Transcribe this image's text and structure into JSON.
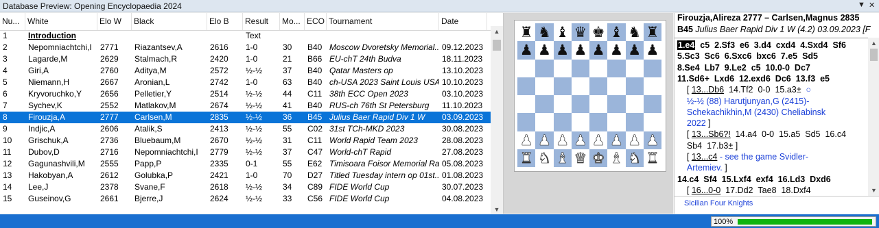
{
  "window": {
    "title": "Database Preview: Opening Encyclopaedia 2024",
    "pin_glyph": "▼",
    "close_glyph": "✕"
  },
  "list": {
    "columns": [
      "Nu...",
      "White",
      "Elo W",
      "Black",
      "Elo B",
      "Result",
      "Mo...",
      "ECO",
      "Tournament",
      "Date"
    ],
    "rows": [
      {
        "num": "1",
        "white": "Introduction",
        "elow": "",
        "black": "",
        "elob": "",
        "result": "Text",
        "moves": "",
        "eco": "",
        "tournament": "",
        "date": ""
      },
      {
        "num": "2",
        "white": "Nepomniachtchi,I",
        "elow": "2771",
        "black": "Riazantsev,A",
        "elob": "2616",
        "result": "1-0",
        "moves": "30",
        "eco": "B40",
        "tournament": "Moscow Dvoretsky Memorial..",
        "date": "09.12.2023"
      },
      {
        "num": "3",
        "white": "Lagarde,M",
        "elow": "2629",
        "black": "Stalmach,R",
        "elob": "2420",
        "result": "1-0",
        "moves": "21",
        "eco": "B66",
        "tournament": "EU-chT 24th Budva",
        "date": "18.11.2023"
      },
      {
        "num": "4",
        "white": "Giri,A",
        "elow": "2760",
        "black": "Aditya,M",
        "elob": "2572",
        "result": "½-½",
        "moves": "37",
        "eco": "B40",
        "tournament": "Qatar Masters op",
        "date": "13.10.2023"
      },
      {
        "num": "5",
        "white": "Niemann,H",
        "elow": "2667",
        "black": "Aronian,L",
        "elob": "2742",
        "result": "1-0",
        "moves": "63",
        "eco": "B40",
        "tournament": "ch-USA 2023 Saint Louis USA",
        "date": "10.10.2023"
      },
      {
        "num": "6",
        "white": "Kryvoruchko,Y",
        "elow": "2656",
        "black": "Pelletier,Y",
        "elob": "2514",
        "result": "½-½",
        "moves": "44",
        "eco": "C11",
        "tournament": "38th ECC Open 2023",
        "date": "03.10.2023"
      },
      {
        "num": "7",
        "white": "Sychev,K",
        "elow": "2552",
        "black": "Matlakov,M",
        "elob": "2674",
        "result": "½-½",
        "moves": "41",
        "eco": "B40",
        "tournament": "RUS-ch 76th St Petersburg",
        "date": "11.10.2023"
      },
      {
        "num": "8",
        "white": "Firouzja,A",
        "elow": "2777",
        "black": "Carlsen,M",
        "elob": "2835",
        "result": "½-½",
        "moves": "36",
        "eco": "B45",
        "tournament": "Julius Baer Rapid Div 1 W",
        "date": "03.09.2023"
      },
      {
        "num": "9",
        "white": "Indjic,A",
        "elow": "2606",
        "black": "Atalik,S",
        "elob": "2413",
        "result": "½-½",
        "moves": "55",
        "eco": "C02",
        "tournament": "31st TCh-MKD 2023",
        "date": "30.08.2023"
      },
      {
        "num": "10",
        "white": "Grischuk,A",
        "elow": "2736",
        "black": "Bluebaum,M",
        "elob": "2670",
        "result": "½-½",
        "moves": "31",
        "eco": "C11",
        "tournament": "World Rapid Team 2023",
        "date": "28.08.2023"
      },
      {
        "num": "11",
        "white": "Dubov,D",
        "elow": "2716",
        "black": "Nepomniachtchi,I",
        "elob": "2779",
        "result": "½-½",
        "moves": "37",
        "eco": "C47",
        "tournament": "World-chT Rapid",
        "date": "27.08.2023"
      },
      {
        "num": "12",
        "white": "Gagunashvili,M",
        "elow": "2555",
        "black": "Papp,P",
        "elob": "2335",
        "result": "0-1",
        "moves": "55",
        "eco": "E62",
        "tournament": "Timisoara Foisor Memorial Ra..",
        "date": "05.08.2023"
      },
      {
        "num": "13",
        "white": "Hakobyan,A",
        "elow": "2612",
        "black": "Golubka,P",
        "elob": "2421",
        "result": "1-0",
        "moves": "70",
        "eco": "D27",
        "tournament": "Titled Tuesday intern op 01st..",
        "date": "01.08.2023"
      },
      {
        "num": "14",
        "white": "Lee,J",
        "elow": "2378",
        "black": "Svane,F",
        "elob": "2618",
        "result": "½-½",
        "moves": "34",
        "eco": "C89",
        "tournament": "FIDE World Cup",
        "date": "30.07.2023"
      },
      {
        "num": "15",
        "white": "Guseinov,G",
        "elow": "2661",
        "black": "Bjerre,J",
        "elob": "2624",
        "result": "½-½",
        "moves": "33",
        "eco": "C56",
        "tournament": "FIDE World Cup",
        "date": "04.08.2023"
      }
    ],
    "selected_index": 7
  },
  "board": {
    "ranks": [
      "r n q k b r",
      "pppppppp",
      "        ",
      "        ",
      "        ",
      "        ",
      "PPPPPPPP",
      "RNBQKBNR"
    ],
    "rank_strings": [
      "rnbqkbnr",
      "pppppppp",
      "........",
      "........",
      "........",
      "........",
      "PPPPPPPP",
      "RNBQKBNR"
    ]
  },
  "notation": {
    "header_players": "Firouzja,Alireza 2777 – Carlsen,Magnus 2835",
    "header_eco": "B45",
    "header_event": "Julius Baer Rapid Div 1 W (4.2) 03.09.2023",
    "header_tail": "[F",
    "lines": [
      [
        {
          "t": "1.e4",
          "c": "mb cur"
        },
        {
          "t": "  c5  2.Sf3  e6  3.d4  cxd4  4.Sxd4  Sf6",
          "c": "mb"
        }
      ],
      [
        {
          "t": "5.Sc3  Sc6  6.Sxc6  bxc6  7.e5  Sd5",
          "c": "mb"
        }
      ],
      [
        {
          "t": "8.Se4  Lb7  9.Le2  c5  10.0-0  Dc7",
          "c": "mb"
        }
      ],
      [
        {
          "t": "11.Sd6+  Lxd6  12.exd6  Dc6  13.f3  e5",
          "c": "mb"
        }
      ],
      [
        {
          "t": "    [ ",
          "c": ""
        },
        {
          "t": "13...Db6",
          "c": "u"
        },
        {
          "t": "  14.Tf2  0-0  15.a3±",
          "c": ""
        },
        {
          "t": "  ○",
          "c": "blue"
        }
      ],
      [
        {
          "t": "    ½-½ (88) Harutjunyan,G (2415)-",
          "c": "blue"
        }
      ],
      [
        {
          "t": "    Schekachikhin,M (2430) Cheliabinsk",
          "c": "blue"
        }
      ],
      [
        {
          "t": "    2022",
          "c": "blue"
        },
        {
          "t": " ]",
          "c": ""
        }
      ],
      [
        {
          "t": "    [ ",
          "c": ""
        },
        {
          "t": "13...Sb6?!",
          "c": "u"
        },
        {
          "t": "  14.a4  0-0  15.a5  Sd5  16.c4",
          "c": ""
        }
      ],
      [
        {
          "t": "    Sb4  17.b3± ]",
          "c": ""
        }
      ],
      [
        {
          "t": "    [ ",
          "c": ""
        },
        {
          "t": "13...c4",
          "c": "u"
        },
        {
          "t": " - see the game Svidler-",
          "c": "blue"
        }
      ],
      [
        {
          "t": "    Artemiev.",
          "c": "blue"
        },
        {
          "t": " ]",
          "c": ""
        }
      ],
      [
        {
          "t": "14.c4  Sf4  15.Lxf4  exf4  16.Ld3  Dxd6",
          "c": "mb"
        }
      ],
      [
        {
          "t": "    [ ",
          "c": ""
        },
        {
          "t": "16...0-0",
          "c": "u"
        },
        {
          "t": "  17.Dd2  Tae8  18.Dxf4",
          "c": ""
        }
      ]
    ],
    "opening_name": "Sicilian Four Knights"
  },
  "status": {
    "zoom": "100%",
    "progress": 1.0
  },
  "colors": {
    "selection": "#0a74d8",
    "status_bar": "#1a6fd0",
    "board_dark": "#9bb5da",
    "progress_fill": "#0fb40f",
    "link_blue": "#1a3fd8"
  }
}
